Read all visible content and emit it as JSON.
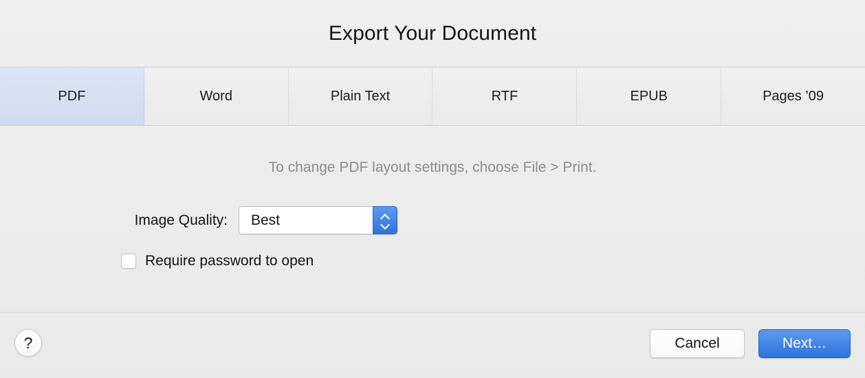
{
  "dialog": {
    "title": "Export Your Document"
  },
  "tabs": [
    {
      "label": "PDF",
      "selected": true
    },
    {
      "label": "Word",
      "selected": false
    },
    {
      "label": "Plain Text",
      "selected": false
    },
    {
      "label": "RTF",
      "selected": false
    },
    {
      "label": "EPUB",
      "selected": false
    },
    {
      "label": "Pages ’09",
      "selected": false
    }
  ],
  "panel": {
    "hint": "To change PDF layout settings, choose File > Print.",
    "image_quality": {
      "label": "Image Quality:",
      "value": "Best"
    },
    "require_password": {
      "label": "Require password to open",
      "checked": false
    }
  },
  "footer": {
    "help_label": "?",
    "cancel_label": "Cancel",
    "next_label": "Next…"
  },
  "colors": {
    "accent_blue": "#2f72dd",
    "selected_tab_bg": "#d6e1f2",
    "window_bg": "#ededed",
    "hint_text": "#8c8c8c"
  }
}
